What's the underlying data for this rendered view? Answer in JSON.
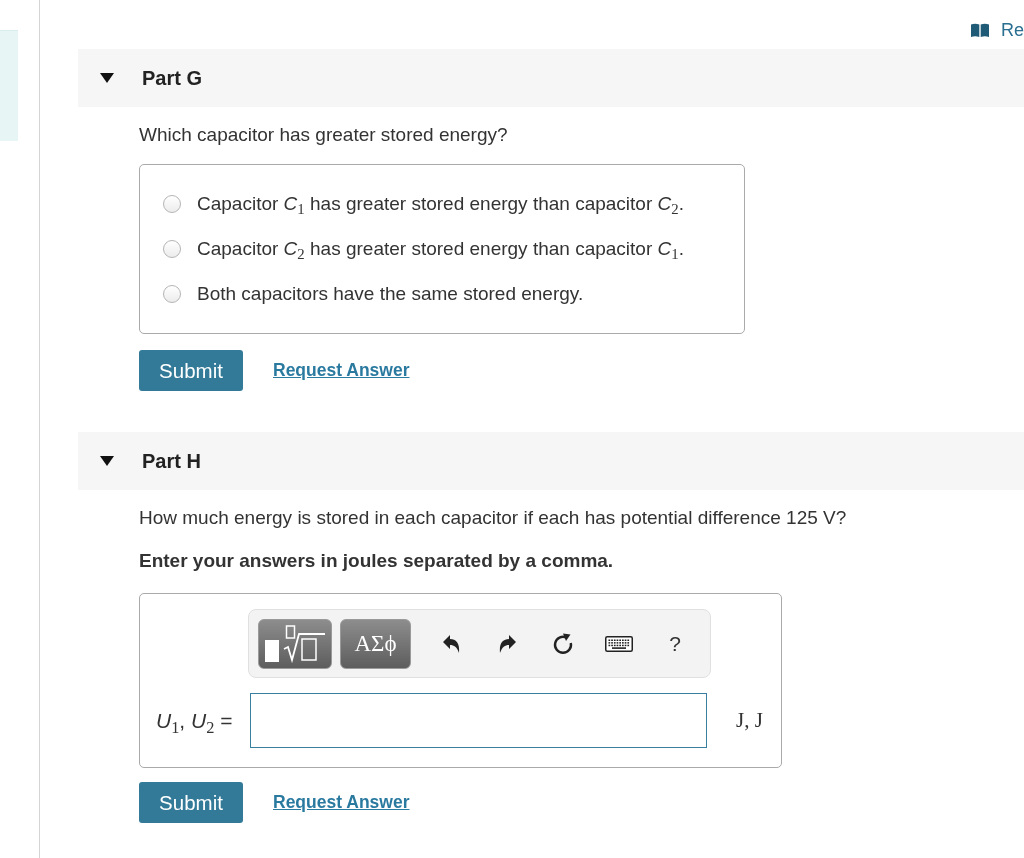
{
  "header_link": {
    "label": "Re"
  },
  "parts": [
    {
      "title": "Part G",
      "expanded": true,
      "kind": "choice",
      "question": "Which capacitor has greater stored energy?",
      "options": [
        {
          "label": "Capacitor *C*$_{1}$ has greater stored energy than capacitor *C*$_{2}$.",
          "selected": false
        },
        {
          "label": "Capacitor *C*$_{2}$ has greater stored energy than capacitor *C*$_{1}$.",
          "selected": false
        },
        {
          "label": "Both capacitors have the same stored energy.",
          "selected": false
        }
      ],
      "submit": "Submit",
      "request_answer": "Request Answer"
    },
    {
      "title": "Part H",
      "expanded": true,
      "kind": "entry",
      "question": "How much energy is stored in each capacitor if each has potential difference 125 V?",
      "instruction": "Enter your answers in joules separated by a comma.",
      "toolbar": {
        "symbols_button": "ΑΣϕ",
        "help_button": "?"
      },
      "answer": {
        "label": "*U*$_{1}$, *U*$_{2}$ =",
        "unit": "J, J"
      },
      "submit": "Submit",
      "request_answer": "Request Answer"
    }
  ]
}
